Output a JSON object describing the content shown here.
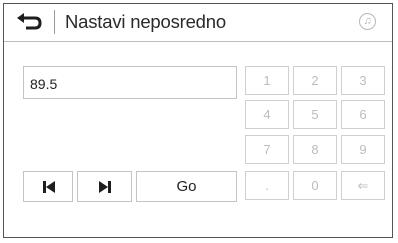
{
  "header": {
    "title": "Nastavi neposredno",
    "back_icon": "back-arrow-icon",
    "source_icon": "music-note-icon",
    "source_glyph": "♫"
  },
  "frequency": {
    "value": "89.5"
  },
  "controls": {
    "prev_icon": "skip-previous-icon",
    "next_icon": "skip-next-icon",
    "go_label": "Go"
  },
  "keypad": {
    "keys": [
      "1",
      "2",
      "3",
      "4",
      "5",
      "6",
      "7",
      "8",
      "9",
      ".",
      "0",
      "⇐"
    ],
    "state": "disabled"
  },
  "colors": {
    "text": "#222222",
    "border": "#c4c4c4",
    "disabled_text": "#bdbdbd"
  }
}
